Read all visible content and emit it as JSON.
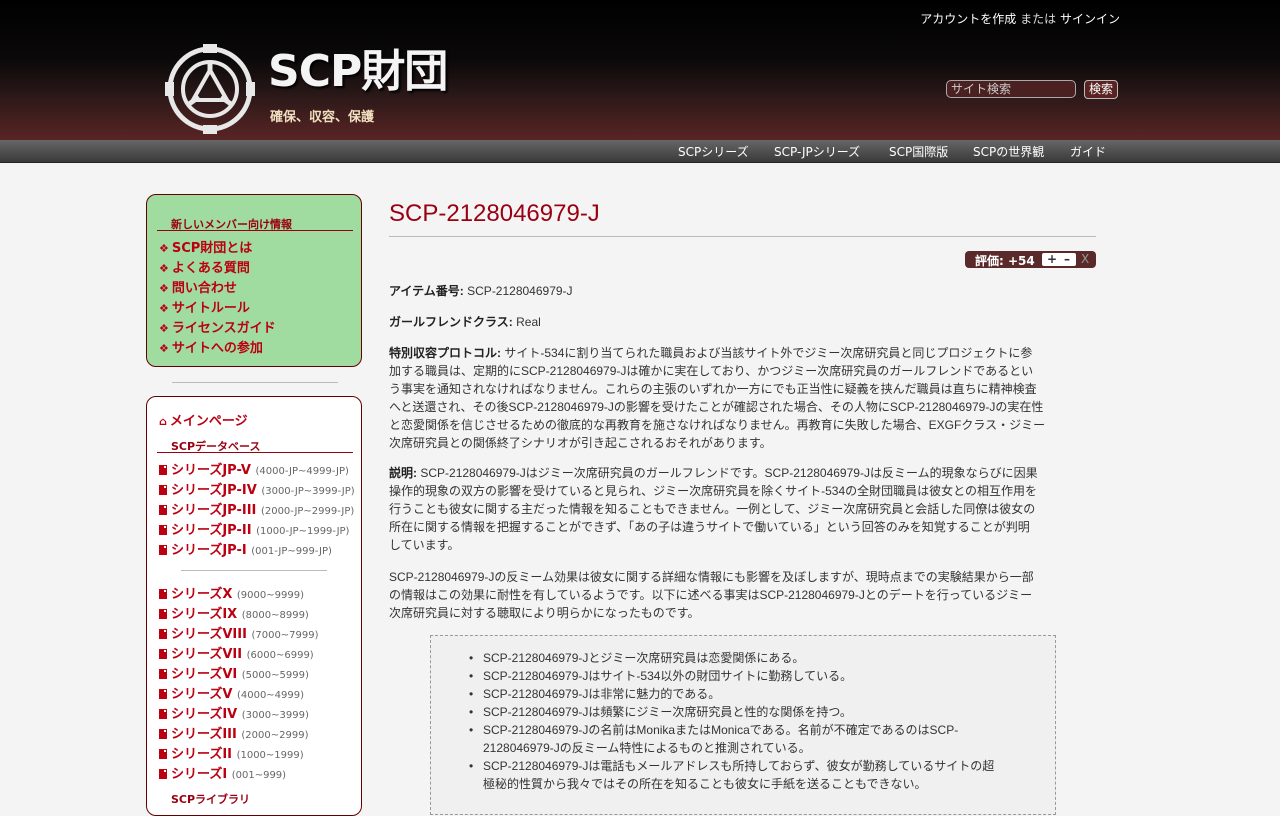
{
  "header": {
    "account": {
      "create": "アカウントを作成",
      "or": "または",
      "signin": "サインイン"
    },
    "site_title": "SCP財団",
    "site_subtitle": "確保、収容、保護",
    "search_placeholder": "サイト検索",
    "search_button": "検索"
  },
  "topnav": [
    "SCPシリーズ",
    "SCP-JPシリーズ",
    "SCP国際版",
    "SCPの世界観",
    "ガイド"
  ],
  "sidebar": {
    "newbox_heading": "新しいメンバー向け情報",
    "newbox_links": [
      "SCP財団とは",
      "よくある質問",
      "問い合わせ",
      "サイトルール",
      "ライセンスガイド",
      "サイトへの参加"
    ],
    "main_page": "メインページ",
    "db_heading": "SCPデータベース",
    "jp_series": [
      {
        "label": "シリーズJP-V",
        "range": "(4000-JP~4999-JP)"
      },
      {
        "label": "シリーズJP-IV",
        "range": "(3000-JP~3999-JP)"
      },
      {
        "label": "シリーズJP-III",
        "range": "(2000-JP~2999-JP)"
      },
      {
        "label": "シリーズJP-II",
        "range": "(1000-JP~1999-JP)"
      },
      {
        "label": "シリーズJP-I",
        "range": "(001-JP~999-JP)"
      }
    ],
    "series": [
      {
        "label": "シリーズX",
        "range": "(9000~9999)"
      },
      {
        "label": "シリーズIX",
        "range": "(8000~8999)"
      },
      {
        "label": "シリーズVIII",
        "range": "(7000~7999)"
      },
      {
        "label": "シリーズVII",
        "range": "(6000~6999)"
      },
      {
        "label": "シリーズVI",
        "range": "(5000~5999)"
      },
      {
        "label": "シリーズV",
        "range": "(4000~4999)"
      },
      {
        "label": "シリーズIV",
        "range": "(3000~3999)"
      },
      {
        "label": "シリーズIII",
        "range": "(2000~2999)"
      },
      {
        "label": "シリーズII",
        "range": "(1000~1999)"
      },
      {
        "label": "シリーズI",
        "range": "(001~999)"
      }
    ],
    "library_heading": "SCPライブラリ"
  },
  "content": {
    "title": "SCP-2128046979-J",
    "rating_label": "評価: +54",
    "rating_plus": "+",
    "rating_minus": "–",
    "rating_x": "X",
    "item_label": "アイテム番号:",
    "item_value": "SCP-2128046979-J",
    "class_label": "ガールフレンドクラス:",
    "class_value": "Real",
    "protocol_label": "特別収容プロトコル:",
    "protocol_lines": [
      "サイト-534に割り当てられた職員および当該サイト外でジミー次席研究員と同じプロジェクトに参",
      "加する職員は、定期的にSCP-2128046979-Jは確かに実在しており、かつジミー次席研究員のガールフレンドであるとい",
      "う事実を通知されなければなりません。これらの主張のいずれか一方にでも正当性に疑義を挟んだ職員は直ちに精神検査",
      "へと送還され、その後SCP-2128046979-Jの影響を受けたことが確認された場合、その人物にSCP-2128046979-Jの実在性",
      "と恋愛関係を信じさせるための徹底的な再教育を施さなければなりません。再教育に失敗した場合、EXGFクラス・ジミー",
      "次席研究員との関係終了シナリオが引き起こされるおそれがあります。"
    ],
    "desc_label": "説明:",
    "desc_lines": [
      "SCP-2128046979-Jはジミー次席研究員のガールフレンドです。SCP-2128046979-Jは反ミーム的現象ならびに因果",
      "操作的現象の双方の影響を受けていると見られ、ジミー次席研究員を除くサイト-534の全財団職員は彼女との相互作用を",
      "行うことも彼女に関する主だった情報を知ることもできません。一例として、ジミー次席研究員と会話した同僚は彼女の",
      "所在に関する情報を把握することができず、「あの子は違うサイトで働いている」という回答のみを知覚することが判明",
      "しています。"
    ],
    "effect_lines": [
      "SCP-2128046979-Jの反ミーム効果は彼女に関する詳細な情報にも影響を及ぼしますが、現時点までの実験結果から一部",
      "の情報はこの効果に耐性を有しているようです。以下に述べる事実はSCP-2128046979-Jとのデートを行っているジミー",
      "次席研究員に対する聴取により明らかになったものです。"
    ],
    "facts": [
      [
        "SCP-2128046979-Jとジミー次席研究員は恋愛関係にある。"
      ],
      [
        "SCP-2128046979-Jはサイト-534以外の財団サイトに勤務している。"
      ],
      [
        "SCP-2128046979-Jは非常に魅力的である。"
      ],
      [
        "SCP-2128046979-Jは頻繁にジミー次席研究員と性的な関係を持つ。"
      ],
      [
        "SCP-2128046979-Jの名前はMonikaまたはMonicaである。名前が不確定であるのはSCP-",
        "2128046979-Jの反ミーム特性によるものと推測されている。"
      ],
      [
        "SCP-2128046979-Jは電話もメールアドレスも所持しておらず、彼女が勤務しているサイトの超",
        "極秘的性質から我々ではその所在を知ることも彼女に手紙を送ることもできない。"
      ]
    ]
  }
}
